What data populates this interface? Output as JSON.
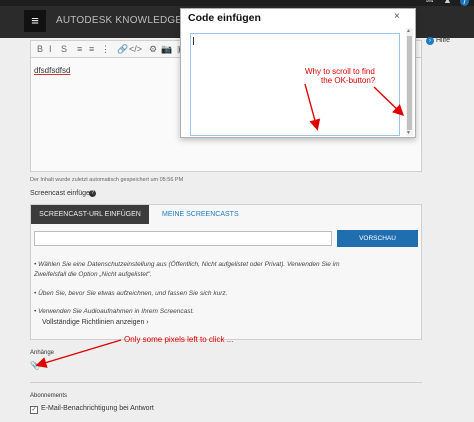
{
  "topbar": {
    "mail_icon": "mail-icon",
    "bell_icon": "bell-icon",
    "badge": "7"
  },
  "header": {
    "menu_glyph": "≡",
    "brand": "AUTODESK KNOWLEDGE NETWORK"
  },
  "toolbar": {
    "tools": [
      "B",
      "I",
      "S",
      "≡",
      "≡",
      "⋮",
      "🔗",
      "</>",
      "⚙",
      "📷",
      "▣",
      "▤"
    ]
  },
  "editor": {
    "text": "dfsdfsdfsd",
    "autosave": "Der Inhalt wurde zuletzt automatisch gespeichert um 05:56 PM"
  },
  "screencast": {
    "label": "Screencast einfügen",
    "help": "?",
    "tab_url": "SCREENCAST-URL EINFÜGEN",
    "tab_mine": "MEINE SCREENCASTS",
    "preview": "VORSCHAU",
    "notes": [
      "• Wählen Sie eine Datenschutzeinstellung aus (Öffentlich, Nicht aufgelistet oder Privat). Verwenden Sie im",
      "  Zweifelsfall die Option „Nicht aufgelistet\".",
      "• Üben Sie, bevor Sie etwas aufzeichnen, und fassen Sie sich kurz.",
      "• Verwenden Sie Audioaufnahmen in Ihrem Screencast."
    ],
    "guide_link": "Vollständige Richtlinien anzeigen ›"
  },
  "attachments": {
    "label": "Anhänge",
    "clip_glyph": "📎"
  },
  "subscriptions": {
    "label": "Abonnements",
    "check_glyph": "✓",
    "email": "E-Mail-Benachrichtigung bei Antwort"
  },
  "help": {
    "arrow": "›",
    "label": "Hilfe"
  },
  "modal": {
    "title": "Code einfügen",
    "close": "×",
    "scroll_up": "▲",
    "scroll_down": "▼"
  },
  "annotations": {
    "scroll_line1": "Why to scroll to find",
    "scroll_line2": "the OK-button?",
    "pixels": "Only some pixels left to click ..."
  },
  "colors": {
    "annotation": "#e00000",
    "accent": "#1f6fb0",
    "header": "#2b2b2b"
  }
}
